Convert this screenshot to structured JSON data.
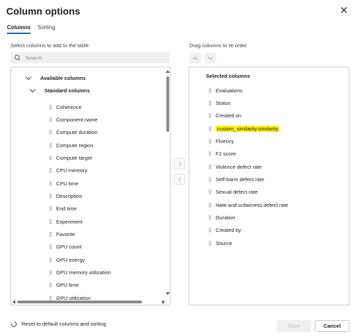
{
  "dialog": {
    "title": "Column options",
    "close_glyph": "✕"
  },
  "tabs": [
    {
      "label": "Columns",
      "active": true
    },
    {
      "label": "Sorting",
      "active": false
    }
  ],
  "left": {
    "label": "Select columns to add to the table",
    "search_placeholder": "Search",
    "groups": {
      "available": "Available columns",
      "standard": "Standard columns"
    },
    "items": [
      "Coherence",
      "Component name",
      "Compute duration",
      "Compute region",
      "Compute target",
      "CPU memory",
      "CPU time",
      "Description",
      "End time",
      "Experiment",
      "Favorite",
      "GPU count",
      "GPU energy",
      "GPU memory utilization",
      "GPU time",
      "GPU utilization"
    ]
  },
  "right": {
    "label": "Drag columns to re-order",
    "header": "Selected columns",
    "items": [
      "Evaluations",
      "Status",
      "Created on",
      "custom_similarity.similarity",
      "Fluency",
      "F1 score",
      "Violence defect rate",
      "Self-harm defect rate",
      "Sexual defect rate",
      "Hate and unfairness defect rate",
      "Duration",
      "Created by",
      "Source"
    ],
    "highlighted": "custom_similarity.similarity"
  },
  "footer": {
    "reset_label": "Reset to default columns and sorting",
    "save_label": "Save",
    "cancel_label": "Cancel"
  },
  "colors": {
    "accent": "#0f6cbd",
    "highlight": "#fff100"
  }
}
